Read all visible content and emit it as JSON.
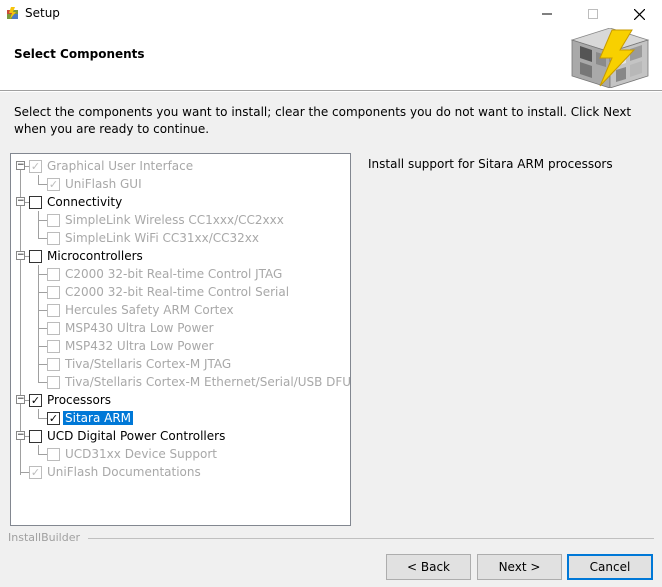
{
  "window": {
    "title": "Setup"
  },
  "header": {
    "title": "Select Components"
  },
  "description": "Select the components you want to install; clear the components you do not want to install. Click Next when you are ready to continue.",
  "tree": [
    {
      "label": "Graphical User Interface",
      "checked": true,
      "disabled": true,
      "expander": true,
      "level": 0
    },
    {
      "label": "UniFlash GUI",
      "checked": true,
      "disabled": true,
      "expander": false,
      "level": 1
    },
    {
      "label": "Connectivity",
      "checked": false,
      "disabled": false,
      "expander": true,
      "level": 0
    },
    {
      "label": "SimpleLink Wireless CC1xxx/CC2xxx",
      "checked": false,
      "disabled": true,
      "expander": false,
      "level": 1
    },
    {
      "label": "SimpleLink WiFi CC31xx/CC32xx",
      "checked": false,
      "disabled": true,
      "expander": false,
      "level": 1
    },
    {
      "label": "Microcontrollers",
      "checked": false,
      "disabled": false,
      "expander": true,
      "level": 0
    },
    {
      "label": "C2000 32-bit Real-time Control JTAG",
      "checked": false,
      "disabled": true,
      "expander": false,
      "level": 1
    },
    {
      "label": "C2000 32-bit Real-time Control Serial",
      "checked": false,
      "disabled": true,
      "expander": false,
      "level": 1
    },
    {
      "label": "Hercules Safety ARM Cortex",
      "checked": false,
      "disabled": true,
      "expander": false,
      "level": 1
    },
    {
      "label": "MSP430 Ultra Low Power",
      "checked": false,
      "disabled": true,
      "expander": false,
      "level": 1
    },
    {
      "label": "MSP432 Ultra Low Power",
      "checked": false,
      "disabled": true,
      "expander": false,
      "level": 1
    },
    {
      "label": "Tiva/Stellaris Cortex-M JTAG",
      "checked": false,
      "disabled": true,
      "expander": false,
      "level": 1
    },
    {
      "label": "Tiva/Stellaris Cortex-M Ethernet/Serial/USB DFU",
      "checked": false,
      "disabled": true,
      "expander": false,
      "level": 1
    },
    {
      "label": "Processors",
      "checked": true,
      "disabled": false,
      "expander": true,
      "level": 0
    },
    {
      "label": "Sitara ARM",
      "checked": true,
      "disabled": false,
      "expander": false,
      "level": 1,
      "selected": true
    },
    {
      "label": "UCD Digital Power Controllers",
      "checked": false,
      "disabled": false,
      "expander": true,
      "level": 0
    },
    {
      "label": "UCD31xx Device Support",
      "checked": false,
      "disabled": true,
      "expander": false,
      "level": 1
    },
    {
      "label": "UniFlash Documentations",
      "checked": true,
      "disabled": true,
      "expander": false,
      "level": 0
    }
  ],
  "info_panel": {
    "text": "Install support for Sitara ARM processors"
  },
  "footer": {
    "brand": "InstallBuilder",
    "back_label": "< Back",
    "next_label": "Next >",
    "cancel_label": "Cancel"
  },
  "icons": {
    "minimize": "minimize-icon",
    "maximize": "maximize-icon",
    "close": "close-icon",
    "app": "setup-app-icon",
    "logo": "installer-cube-lightning-logo"
  }
}
